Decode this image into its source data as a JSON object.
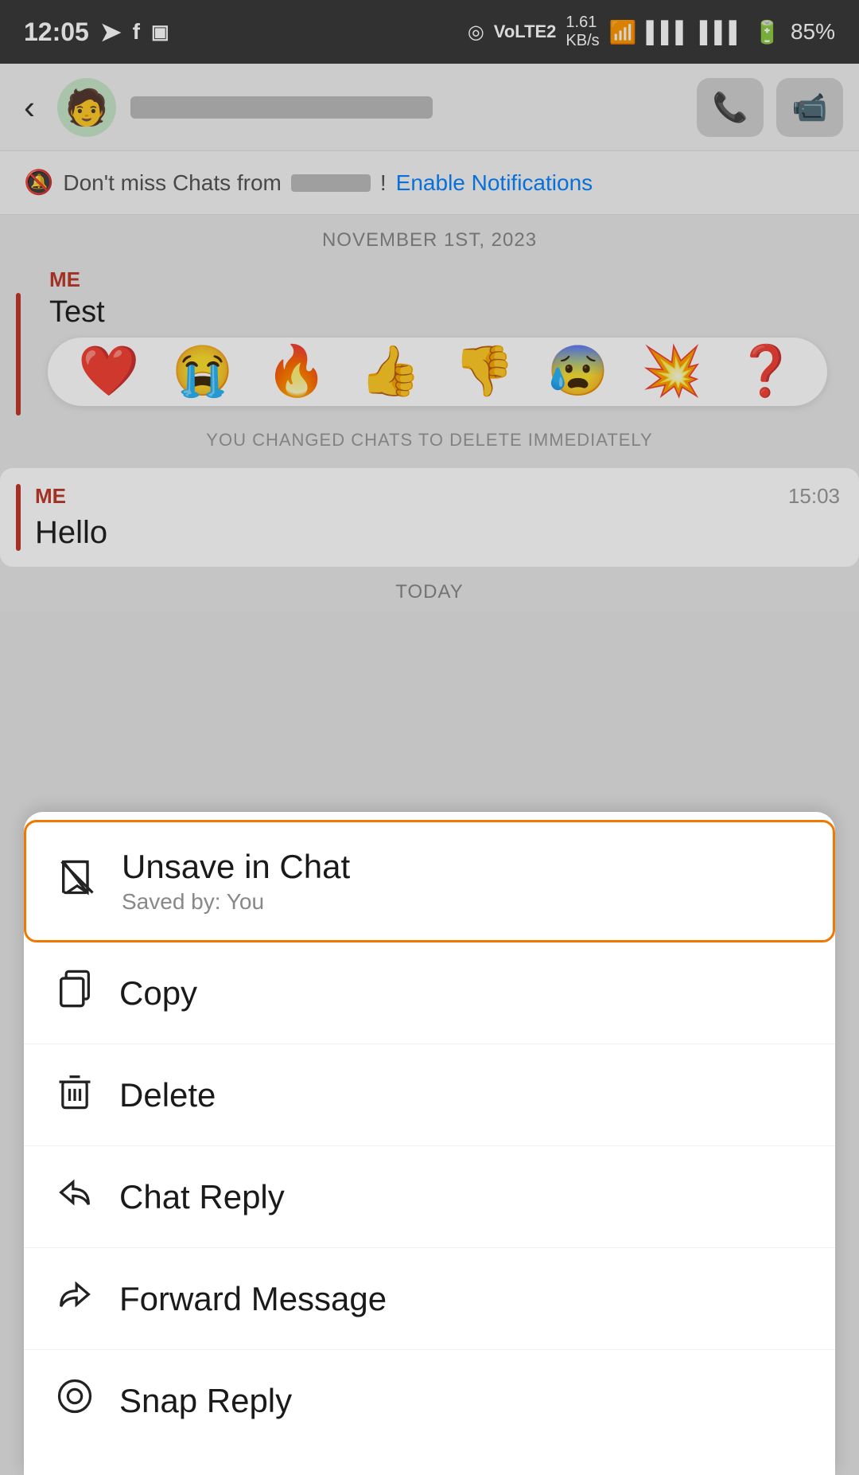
{
  "statusBar": {
    "time": "12:05",
    "battery": "85%",
    "icons": [
      "location",
      "volte",
      "speed",
      "wifi",
      "signal1",
      "signal2",
      "battery"
    ]
  },
  "header": {
    "backLabel": "‹",
    "contactNameBlurred": true,
    "callIcon": "📞",
    "videoIcon": "📹"
  },
  "notificationBanner": {
    "bellIcon": "🔕",
    "preText": "Don't miss Chats from",
    "nameBlurred": true,
    "linkText": "Enable Notifications"
  },
  "dateSeparator": "NOVEMBER 1ST, 2023",
  "messages": [
    {
      "sender": "ME",
      "text": "Test",
      "time": null
    },
    {
      "sender": "ME",
      "text": "Hello",
      "time": "15:03"
    }
  ],
  "systemMessage": "YOU CHANGED CHATS TO DELETE IMMEDIATELY",
  "todaySeparator": "TODAY",
  "emojis": [
    "❤️",
    "😭",
    "🔥",
    "👍",
    "👎",
    "😰",
    "💥",
    "❓"
  ],
  "contextMenu": {
    "items": [
      {
        "id": "unsave",
        "label": "Unsave in Chat",
        "sublabel": "Saved by: You",
        "highlighted": true
      },
      {
        "id": "copy",
        "label": "Copy",
        "sublabel": null,
        "highlighted": false
      },
      {
        "id": "delete",
        "label": "Delete",
        "sublabel": null,
        "highlighted": false
      },
      {
        "id": "chat-reply",
        "label": "Chat Reply",
        "sublabel": null,
        "highlighted": false
      },
      {
        "id": "forward",
        "label": "Forward Message",
        "sublabel": null,
        "highlighted": false
      },
      {
        "id": "snap-reply",
        "label": "Snap Reply",
        "sublabel": null,
        "highlighted": false
      }
    ]
  }
}
